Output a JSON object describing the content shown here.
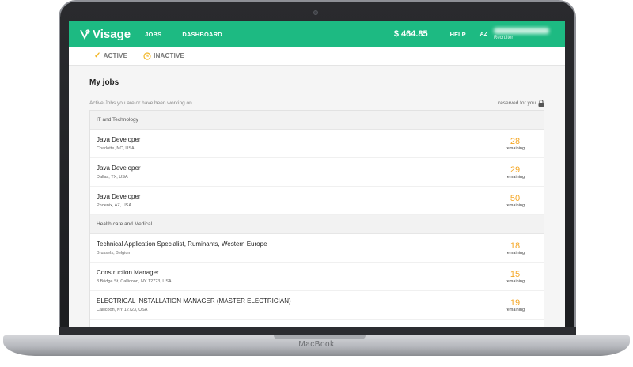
{
  "device": {
    "brand": "MacBook"
  },
  "header": {
    "logo_text": "Visage",
    "nav": [
      {
        "label": "JOBS"
      },
      {
        "label": "DASHBOARD"
      }
    ],
    "balance": "$ 464.85",
    "help_label": "HELP",
    "user_initials": "AZ",
    "user_role": "Recruiter",
    "colors": {
      "brand": "#1dba82"
    }
  },
  "tabs": [
    {
      "label": "ACTIVE",
      "icon": "check-icon"
    },
    {
      "label": "INACTIVE",
      "icon": "clock-icon"
    }
  ],
  "main": {
    "title": "My jobs",
    "subtitle": "Active Jobs you are or have been working on",
    "reserved_label": "reserved for you",
    "categories": [
      {
        "name": "IT and Technology",
        "jobs": [
          {
            "title": "Java Developer",
            "location": "Charlotte, NC, USA",
            "count": "28",
            "count_label": "remaining"
          },
          {
            "title": "Java Developer",
            "location": "Dallas, TX, USA",
            "count": "29",
            "count_label": "remaining"
          },
          {
            "title": "Java Developer",
            "location": "Phoenix, AZ, USA",
            "count": "50",
            "count_label": "remaining"
          }
        ]
      },
      {
        "name": "Health care and Medical",
        "jobs": [
          {
            "title": "Technical Application Specialist, Ruminants, Western Europe",
            "location": "Brussels, Belgium",
            "count": "18",
            "count_label": "remaining"
          },
          {
            "title": "Construction Manager",
            "location": "3 Bridge St, Callicoon, NY 12723, USA",
            "count": "15",
            "count_label": "remaining"
          },
          {
            "title": "ELECTRICAL INSTALLATION MANAGER (MASTER ELECTRICIAN)",
            "location": "Callicoon, NY 12723, USA",
            "count": "19",
            "count_label": "remaining"
          }
        ]
      }
    ],
    "colors": {
      "count": "#f5a623"
    }
  }
}
